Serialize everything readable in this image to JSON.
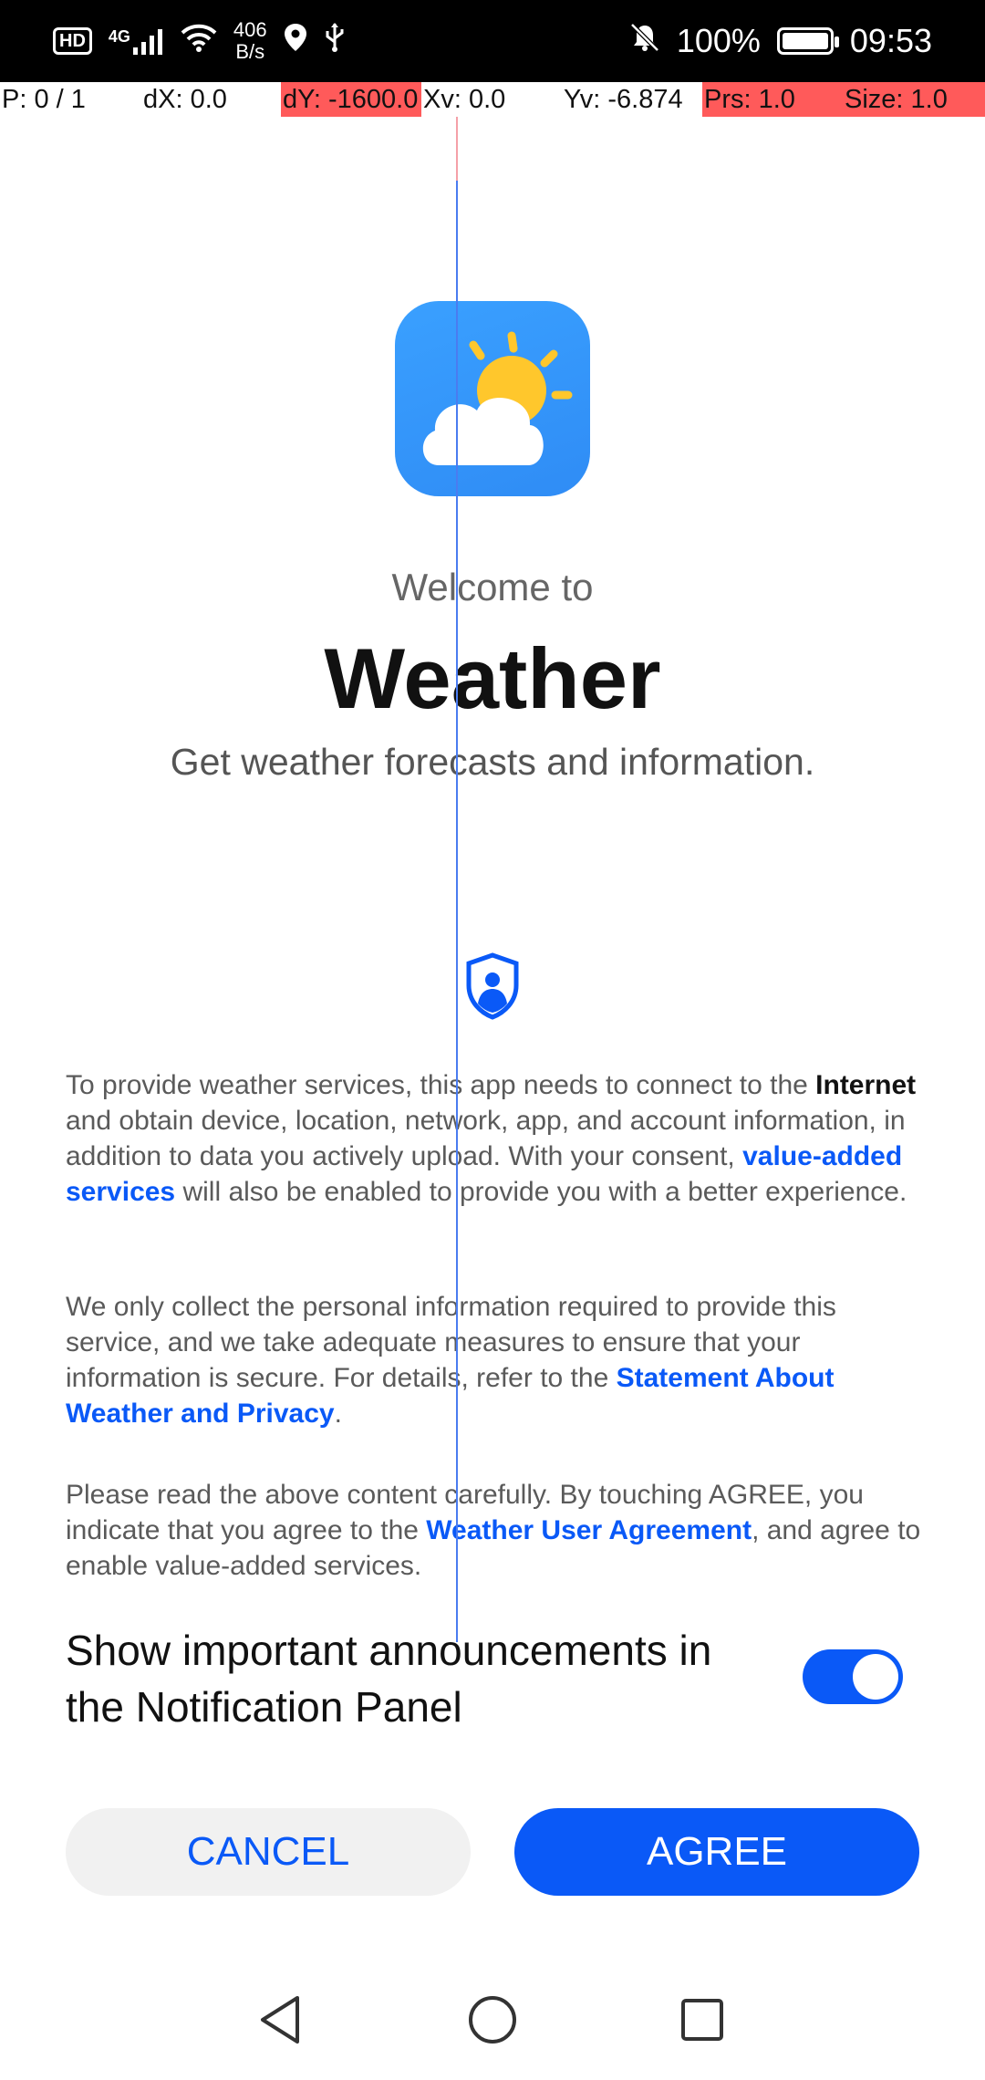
{
  "status_bar": {
    "hd": "HD",
    "network": "4G",
    "net_speed_value": "406",
    "net_speed_unit": "B/s",
    "battery": "100%",
    "time": "09:53"
  },
  "debug": {
    "p": "P: 0 / 1",
    "dx": "dX: 0.0",
    "dy": "dY: -1600.0",
    "xv": "Xv: 0.0",
    "yv": "Yv: -6.874",
    "prs": "Prs: 1.0",
    "size": "Size: 1.0"
  },
  "header": {
    "welcome": "Welcome to",
    "app_name": "Weather",
    "tagline": "Get weather forecasts and information."
  },
  "privacy": {
    "p1_a": "To provide weather services, this app needs to connect to the ",
    "p1_internet": "Internet",
    "p1_b": " and obtain device, location, network, app, and account information, in addition to data you actively upload. With your consent, ",
    "p1_link": "value-added services",
    "p1_c": " will also be enabled to provide you with a better experience.",
    "p2_a": "We only collect the personal information required to provide this service, and we take adequate measures to ensure that your information is secure. For details, refer to the ",
    "p2_link": "Statement About Weather and Privacy",
    "p2_b": ".",
    "p3_a": "Please read the above content carefully. By touching AGREE, you indicate that you agree to the ",
    "p3_link": "Weather User Agreement",
    "p3_b": ", and agree to enable value-added services."
  },
  "notification_setting": {
    "label": "Show important announcements in the Notification Panel",
    "enabled": true
  },
  "buttons": {
    "cancel": "CANCEL",
    "agree": "AGREE"
  },
  "colors": {
    "accent": "#0a59f7",
    "icon_bg": "#3aa0ff",
    "sun": "#ffc72c"
  },
  "nav_icons": [
    "back-triangle-icon",
    "home-circle-icon",
    "recents-square-icon"
  ]
}
